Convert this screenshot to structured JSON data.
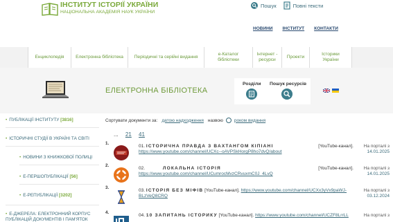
{
  "header": {
    "title": "ІНСТИТУТ ІСТОРІЇ УКРАЇНИ",
    "subtitle": "НАЦІОНАЛЬНА АКАДЕМІЯ НАУК УКРАЇНИ",
    "search_label": "Пошук",
    "fulltext_label": "Повні тексти",
    "nav": [
      "НОВИНИ",
      "ІНСТИТУТ",
      "КОНТАКТИ"
    ]
  },
  "subnav": [
    "Енциклопедія",
    "Електронна бібліотека",
    "Періодичні та серійні видання",
    "е-Каталог бібліотеки",
    "Інтернет - ресурси",
    "Проекти",
    "Історики України"
  ],
  "banner": {
    "title": "ЕЛЕКТРОННА БІБЛІОТЕКА",
    "sections_label": "Розділи",
    "search_label": "Пошук ресурсів"
  },
  "sidebar": {
    "items": [
      {
        "label": "ПУБЛІКАЦІЇ ІНСТИТУТУ",
        "count": "[3816]"
      },
      {
        "label": "ІСТОРИЧНІ СТУДІЇ В УКРАЇНІ ТА СВІТІ",
        "count": ""
      },
      {
        "label": "НОВИНИ З КНИЖКОВОЇ ПОЛИЦІ",
        "count": ""
      },
      {
        "label": "Е-ПЕРШОПУБЛІКАЦІЇ",
        "count": "[56]"
      },
      {
        "label": "Е-РЕПУБЛІКАЦІЇ",
        "count": "[3202]"
      },
      {
        "label": "Е-ДЖЕРЕЛА: ЕЛЕКТРОННИЙ КОРПУС ПУБЛІКАЦІЙ ДОКУМЕНТІВ І ПАМ'ЯТОК",
        "count": ""
      }
    ]
  },
  "sort": {
    "label": "Сортувати документи за:",
    "by_date": "датою надходження",
    "by_name": "назвою",
    "by_year": "роком видання"
  },
  "pager": {
    "dots": "...",
    "pages": [
      "21",
      "41"
    ]
  },
  "rows": [
    {
      "num": "1.",
      "index": "01.",
      "title": "ІСТОРИЧНА ПРАВДА З ВАХТАНГОМ КІПІАНІ",
      "type": "[YouTube-канал].",
      "url": "https://www.youtube.com/channel/UCXc--oAVPSkHorgP8ho7dvQ/about",
      "date_label": "На порталі з",
      "date": "14.01.2025"
    },
    {
      "num": "2.",
      "index": "02.",
      "title": "ЛОКАЛЬНА ІСТОРІЯ",
      "type": "[YouTube-канал].",
      "url": "https://www.youtube.com/channel/UCumrocMvzCRvuxmC0J_4LvQ",
      "date_label": "На порталі з",
      "date": "14.01.2025"
    },
    {
      "num": "3.",
      "index": "03.",
      "title": "ІСТОРІЯ БЕЗ МІФІВ",
      "type": "[YouTube-канал].",
      "url": "https://www.youtube.com/channel/UCXx3yVx9paWJ-BLzVeQ8CRQ",
      "date_label": "На порталі з",
      "date": "03.12.2024"
    },
    {
      "num": "4.",
      "index": "04.",
      "title": "10 ЗАПИТАНЬ ІСТОРИКУ",
      "type": "[YouTube-канал].",
      "url": "https://www.youtube.com/channel/UCZF8LrrLL",
      "date_label": "На порталі з",
      "date": ""
    }
  ],
  "colors": {
    "green": "#7aa93a",
    "teal": "#3d7d8c",
    "navy": "#2a4a70"
  }
}
